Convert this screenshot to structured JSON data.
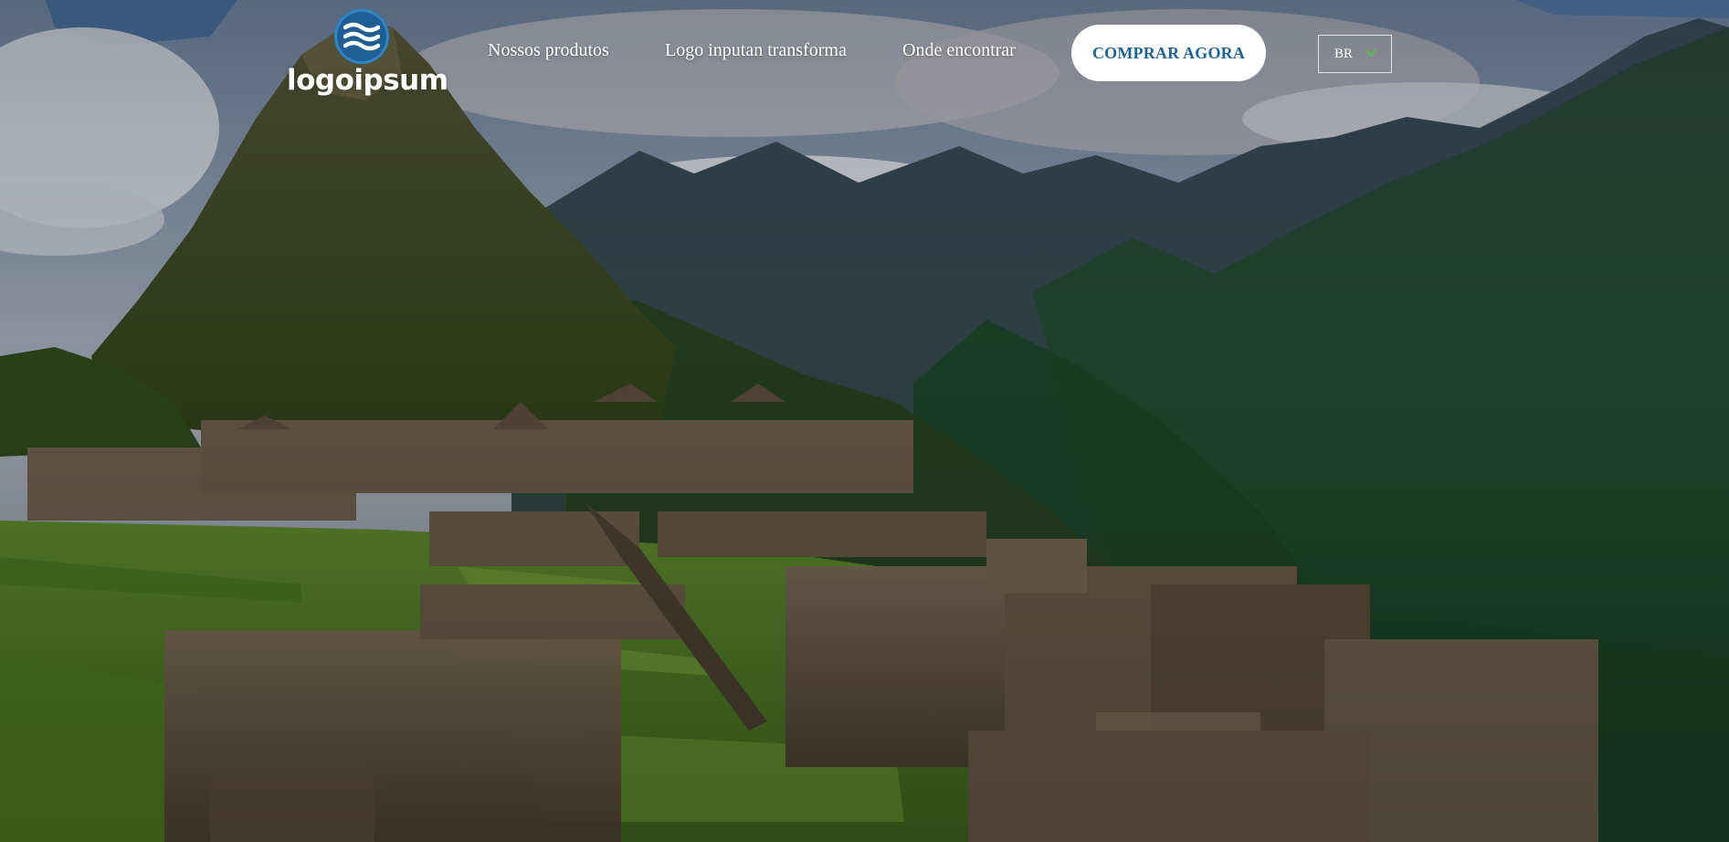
{
  "brand": {
    "name": "logoipsum",
    "mark_color": "#1f5f93"
  },
  "nav": {
    "items": [
      {
        "label": "Nossos produtos"
      },
      {
        "label": "Logo inputan transforma"
      },
      {
        "label": "Onde encontrar"
      }
    ]
  },
  "cta": {
    "label": "COMPRAR AGORA",
    "text_color": "#1f6396"
  },
  "language": {
    "selected": "BR",
    "chevron_color": "#57b947",
    "icon": "chevron-down-icon"
  },
  "hero": {
    "image": "Machu Picchu ruins with mountains and clouds"
  }
}
